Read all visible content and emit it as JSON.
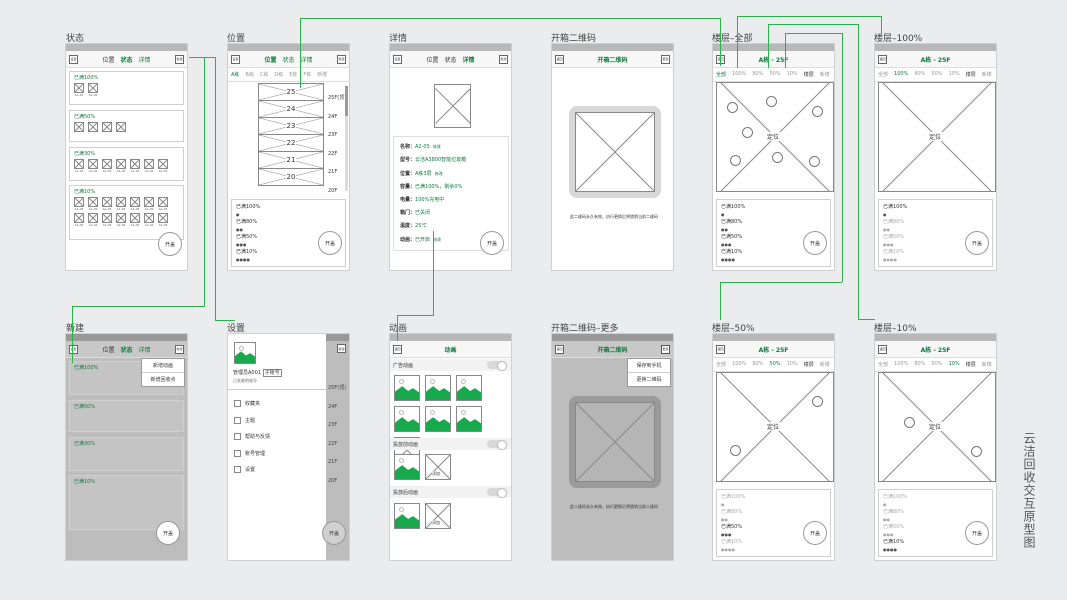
{
  "side_title": "云洁回收交互原型图",
  "screens": {
    "status": {
      "label": "状态",
      "nav": [
        "设置",
        "位置",
        "状态",
        "详情",
        "新建"
      ],
      "cards": [
        {
          "title": "已满100%",
          "rows": [
            [
              "A1-05",
              "A1-05"
            ]
          ]
        },
        {
          "title": "已满50%",
          "rows": [
            [
              "",
              "",
              "",
              ""
            ]
          ]
        },
        {
          "title": "已满30%",
          "rows": [
            [
              "A1-05",
              "A1-05",
              "A1-05",
              "A1-05",
              "A1-05",
              "A1-05",
              "A1-05"
            ]
          ]
        },
        {
          "title": "已满10%",
          "rows": [
            [
              "A1-05",
              "A1-05",
              "A1-05",
              "A1-05",
              "A1-05",
              "A1-05",
              "A1-05"
            ],
            [
              "A1-05",
              "A1-05",
              "A1-05",
              "A1-05",
              "A1-05",
              "A1-05",
              "A1-05"
            ]
          ]
        }
      ],
      "button": "开盖"
    },
    "location": {
      "label": "位置",
      "nav": [
        "设置",
        "位置",
        "状态",
        "详情",
        "新建"
      ],
      "tabs": [
        "A栋",
        "B栋",
        "C栋",
        "D栋",
        "E栋",
        "F栋",
        "新楼"
      ],
      "floors": [
        "25",
        "24",
        "23",
        "22",
        "21",
        "20"
      ],
      "floor_labels": [
        "25F(顶)",
        "24F",
        "23F",
        "22F",
        "21F",
        "20F"
      ],
      "legend": [
        "已满100%",
        "已满80%",
        "已满50%",
        "已满10%"
      ],
      "button": "开盖"
    },
    "detail": {
      "label": "详情",
      "nav": [
        "设置",
        "位置",
        "状态",
        "详情",
        "新建"
      ],
      "fields": [
        [
          "名称：",
          "A2-05",
          "修改"
        ],
        [
          "型号：",
          "云洁A3800智能垃圾箱",
          ""
        ],
        [
          "位置：",
          "A栋3层",
          "修改"
        ],
        [
          "容量：",
          "已满100%，剩余0%",
          ""
        ],
        [
          "电量：",
          "100%充电中",
          ""
        ],
        [
          "箱门：",
          "已关闭",
          ""
        ],
        [
          "温度：",
          "25℃",
          ""
        ],
        [
          "动画：",
          "已开启",
          "修改"
        ]
      ],
      "button": "开盖"
    },
    "qr": {
      "label": "开箱二维码",
      "nav": [
        "返回",
        "开箱二维码",
        "更多"
      ],
      "note": "此二维码永久有效，执行更换后将锁销当前二维码"
    },
    "floor_all": {
      "label": "楼层–全部",
      "nav": [
        "返回",
        "A栋 - 25F"
      ],
      "tabs": [
        "全部",
        "100%",
        "80%",
        "50%",
        "10%",
        "楼层",
        "新楼"
      ],
      "center": "定位",
      "legend": [
        "已满100%",
        "已满80%",
        "已满50%",
        "已满10%"
      ],
      "button": "开盖"
    },
    "floor_100": {
      "label": "楼层–100%",
      "nav": [
        "返回",
        "A栋 - 25F"
      ],
      "tabs": [
        "全部",
        "100%",
        "80%",
        "50%",
        "10%",
        "楼层",
        "新楼"
      ],
      "center": "定位",
      "legend": [
        "已满100%",
        "已满80%",
        "已满50%",
        "已满10%"
      ],
      "button": "开盖"
    },
    "new": {
      "label": "新建",
      "nav": [
        "设置",
        "位置",
        "状态",
        "详情",
        "新建"
      ],
      "menu": [
        "新增动画",
        "新增回收点"
      ],
      "button": "开盖"
    },
    "settings": {
      "label": "设置",
      "user": "管理员A001",
      "role": "子账号",
      "sub": "已关联的账号",
      "items": [
        "收藏夹",
        "主题",
        "帮助与反馈",
        "账号管理",
        "设置"
      ]
    },
    "animation": {
      "label": "动画",
      "nav": [
        "返回",
        "动画"
      ],
      "sections": [
        "广告动画",
        "投放前动画",
        "投放后动画"
      ],
      "add": "添加"
    },
    "qr_more": {
      "label": "开箱二维码–更多",
      "nav": [
        "返回",
        "开箱二维码",
        "更多"
      ],
      "menu": [
        "保存到手机",
        "更换二维码"
      ],
      "note": "此二维码永久有效，执行更换后将锁销当前二维码"
    },
    "floor_50": {
      "label": "楼层–50%",
      "nav": [
        "返回",
        "A栋 - 25F"
      ],
      "tabs": [
        "全部",
        "100%",
        "80%",
        "50%",
        "10%",
        "楼层",
        "新楼"
      ],
      "center": "定位",
      "legend": [
        "已满100%",
        "已满80%",
        "已满50%",
        "已满10%"
      ],
      "button": "开盖"
    },
    "floor_10": {
      "label": "楼层–10%",
      "nav": [
        "返回",
        "A栋 - 25F"
      ],
      "tabs": [
        "全部",
        "100%",
        "80%",
        "50%",
        "10%",
        "楼层",
        "新楼"
      ],
      "center": "定位",
      "legend": [
        "已满100%",
        "已满80%",
        "已满50%",
        "已满10%"
      ],
      "button": "开盖"
    }
  },
  "colors": {
    "accent": "#0e7a3c",
    "wire": "#2bb24c",
    "fill": "#18a94e"
  }
}
